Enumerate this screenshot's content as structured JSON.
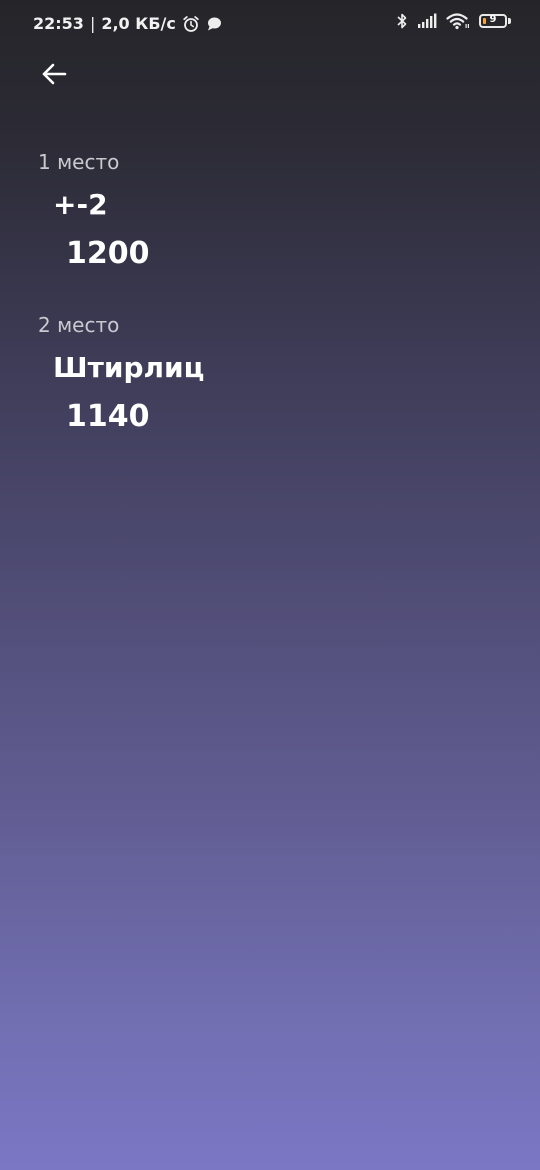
{
  "status_bar": {
    "time": "22:53",
    "separator": "|",
    "network_speed": "2,0 КБ/с",
    "icons_left": [
      "alarm-icon",
      "chat-bubble-icon"
    ],
    "icons_right": [
      "bluetooth-icon",
      "cellular-signal-icon",
      "wifi-icon",
      "battery-icon"
    ],
    "battery_level": "9",
    "battery_color": "#f4a23c"
  },
  "header": {
    "back_icon": "arrow-left-icon"
  },
  "leaderboard": {
    "entries": [
      {
        "place": "1 место",
        "name": "+-2",
        "score": "1200"
      },
      {
        "place": "2 место",
        "name": "Штирлиц",
        "score": "1140"
      }
    ]
  },
  "colors": {
    "gradient_top": "#252529",
    "gradient_bottom": "#7b77c4",
    "place_text": "#c9c9cf",
    "primary_text": "#ffffff"
  }
}
